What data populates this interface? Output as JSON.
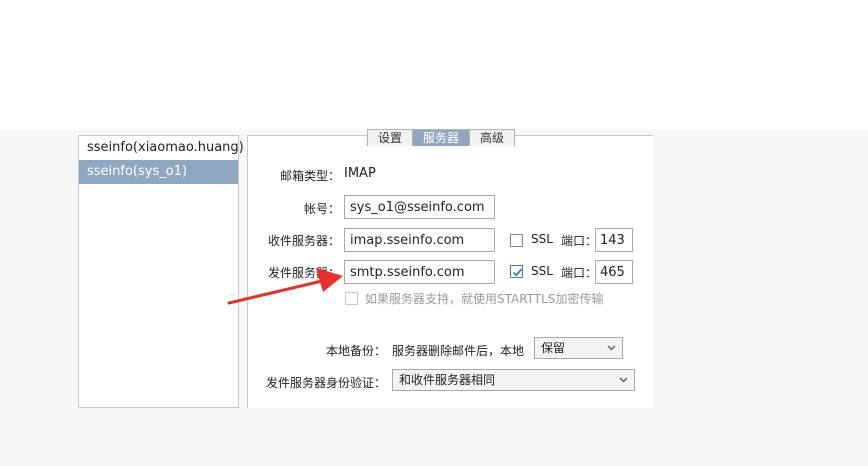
{
  "accounts": [
    {
      "label": "sseinfo(xiaomao.huang)",
      "selected": false
    },
    {
      "label": "sseinfo(sys_o1)",
      "selected": true
    }
  ],
  "tabs": [
    {
      "label": "设置",
      "active": false
    },
    {
      "label": "服务器",
      "active": true
    },
    {
      "label": "高级",
      "active": false
    }
  ],
  "server": {
    "mailbox_type_label": "邮箱类型：",
    "mailbox_type_value": "IMAP",
    "account_label": "帐号：",
    "account_value": "sys_o1@sseinfo.com",
    "incoming_label": "收件服务器：",
    "incoming_value": "imap.sseinfo.com",
    "incoming_ssl_label": "SSL",
    "incoming_ssl_checked": false,
    "incoming_port_label": "端口：",
    "incoming_port_value": "143",
    "outgoing_label": "发件服务器：",
    "outgoing_value": "smtp.sseinfo.com",
    "outgoing_ssl_label": "SSL",
    "outgoing_ssl_checked": true,
    "outgoing_port_label": "端口：",
    "outgoing_port_value": "465",
    "starttls_label": "如果服务器支持，就使用STARTTLS加密传输",
    "starttls_checked": false
  },
  "backup": {
    "label": "本地备份：",
    "description": "服务器删除邮件后，本地",
    "selected": "保留"
  },
  "auth": {
    "label": "发件服务器身份验证：",
    "selected": "和收件服务器相同"
  },
  "colors": {
    "selection": "#8fa7c0",
    "annotation_arrow": "#e8302a",
    "checkbox_check": "#2f7bd1"
  },
  "icons": {
    "dropdown": "chevron-down-icon",
    "checkmark": "checkmark-icon",
    "annotation": "red-arrow-icon"
  }
}
